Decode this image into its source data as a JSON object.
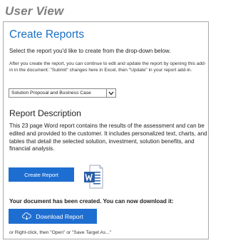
{
  "view_title": "User View",
  "create": {
    "heading": "Create Reports",
    "intro": "Select the report you'd like to create from the drop-down below.",
    "note": "After you create the report, you can continue to edit and update the report by opening this add-in in the document: \"Submit\" changes here in Excel, then \"Update\" in your report add-in.",
    "select_value": "Solution Proposal and Business Case"
  },
  "description": {
    "heading": "Report Description",
    "text": "This 23 page Word report contains the results of the assessment and can be edited and provided to the customer. It includes personalized text, charts, and tables that detail the selected solution, investment, solution benefits, and financial analysis."
  },
  "actions": {
    "create_label": "Create Report",
    "word_icon": "word-doc-icon",
    "created_message": "Your document has been created. You can now download it:",
    "download_label": "Download Report",
    "download_icon": "cloud-download-icon",
    "alt_hint": "or Right-click, then \"Open\" or \"Save Target As...\""
  },
  "colors": {
    "accent": "#1e6ed1",
    "heading_blue": "#1b6fc4",
    "view_title_gray": "#7f7f7f"
  }
}
